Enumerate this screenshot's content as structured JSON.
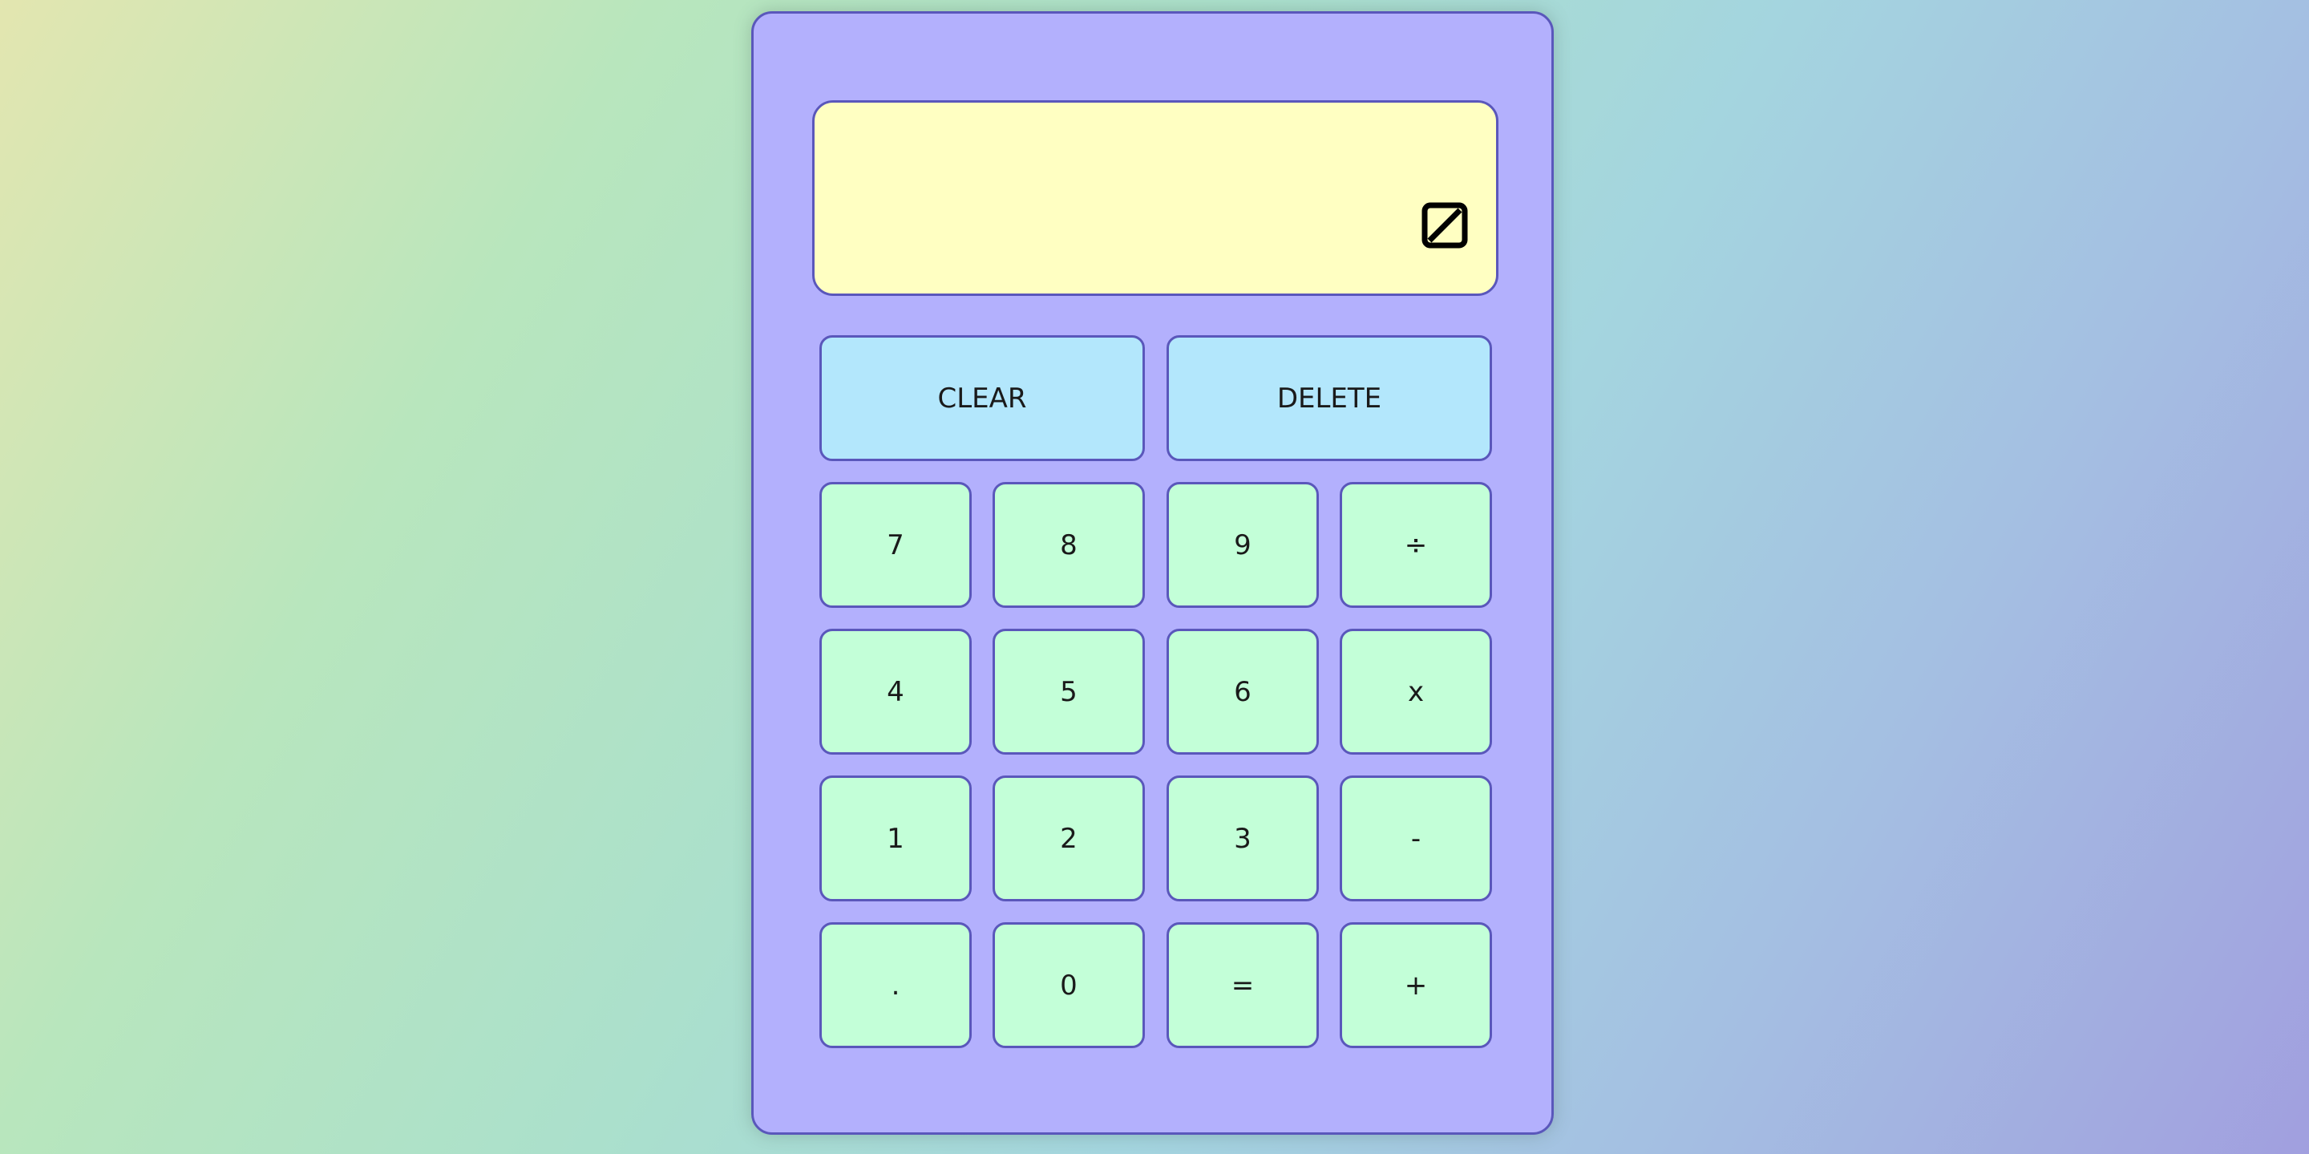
{
  "display": {
    "value": "",
    "icon": "square-slash-icon"
  },
  "controls": {
    "clear_label": "CLEAR",
    "delete_label": "DELETE"
  },
  "keys": {
    "k7": "7",
    "k8": "8",
    "k9": "9",
    "divide": "÷",
    "k4": "4",
    "k5": "5",
    "k6": "6",
    "multiply": "x",
    "k1": "1",
    "k2": "2",
    "k3": "3",
    "subtract": "-",
    "decimal": ".",
    "k0": "0",
    "equals": "=",
    "add": "+"
  },
  "colors": {
    "body": "#b3b0fd",
    "display": "#ffffc2",
    "control_button": "#b3e7fc",
    "key_button": "#c3ffd8",
    "border": "#5a57bb"
  }
}
